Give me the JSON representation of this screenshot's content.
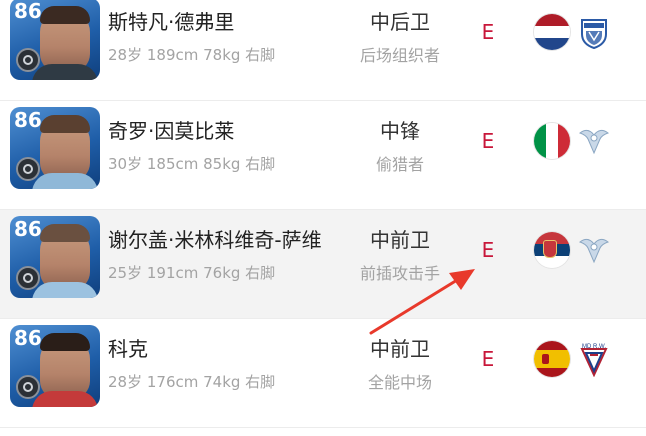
{
  "players": [
    {
      "rating": "86",
      "name": "斯特凡·德弗里",
      "meta": "28岁 189cm 78kg 右脚",
      "position": "中后卫",
      "role": "后场组织者",
      "grade": "E",
      "flag_icon": "netherlands-flag-icon",
      "flag_colors": [
        "#ae1c28",
        "#ffffff",
        "#21468b"
      ],
      "club_icon": "lazio-style-shield-icon",
      "highlighted": false
    },
    {
      "rating": "86",
      "name": "奇罗·因莫比莱",
      "meta": "30岁 185cm 85kg 右脚",
      "position": "中锋",
      "role": "偷猎者",
      "grade": "E",
      "flag_icon": "italy-flag-icon",
      "flag_colors": [
        "#009246",
        "#ffffff",
        "#ce2b37"
      ],
      "club_icon": "lazio-eagle-icon",
      "highlighted": false
    },
    {
      "rating": "86",
      "name": "谢尔盖·米林科维奇-萨维",
      "meta": "25岁 191cm 76kg 右脚",
      "position": "中前卫",
      "role": "前插攻击手",
      "grade": "E",
      "flag_icon": "serbia-flag-icon",
      "flag_colors": [
        "#c6363c",
        "#0c4076",
        "#ffffff"
      ],
      "club_icon": "lazio-eagle-icon",
      "highlighted": true
    },
    {
      "rating": "86",
      "name": "科克",
      "meta": "28岁 176cm 74kg 右脚",
      "position": "中前卫",
      "role": "全能中场",
      "grade": "E",
      "flag_icon": "spain-flag-icon",
      "flag_colors": [
        "#aa151b",
        "#f1bf00",
        "#aa151b"
      ],
      "club_icon": "md-rw-club-icon",
      "club_text": "MD R.W.",
      "highlighted": false
    }
  ],
  "annotation": {
    "arrow_color": "#e8392b",
    "arrow_icon": "red-arrow-icon"
  },
  "colors": {
    "grade": "#c8173a",
    "muted_text": "#a3a3a3",
    "card_blue": "#1f5ea8"
  }
}
